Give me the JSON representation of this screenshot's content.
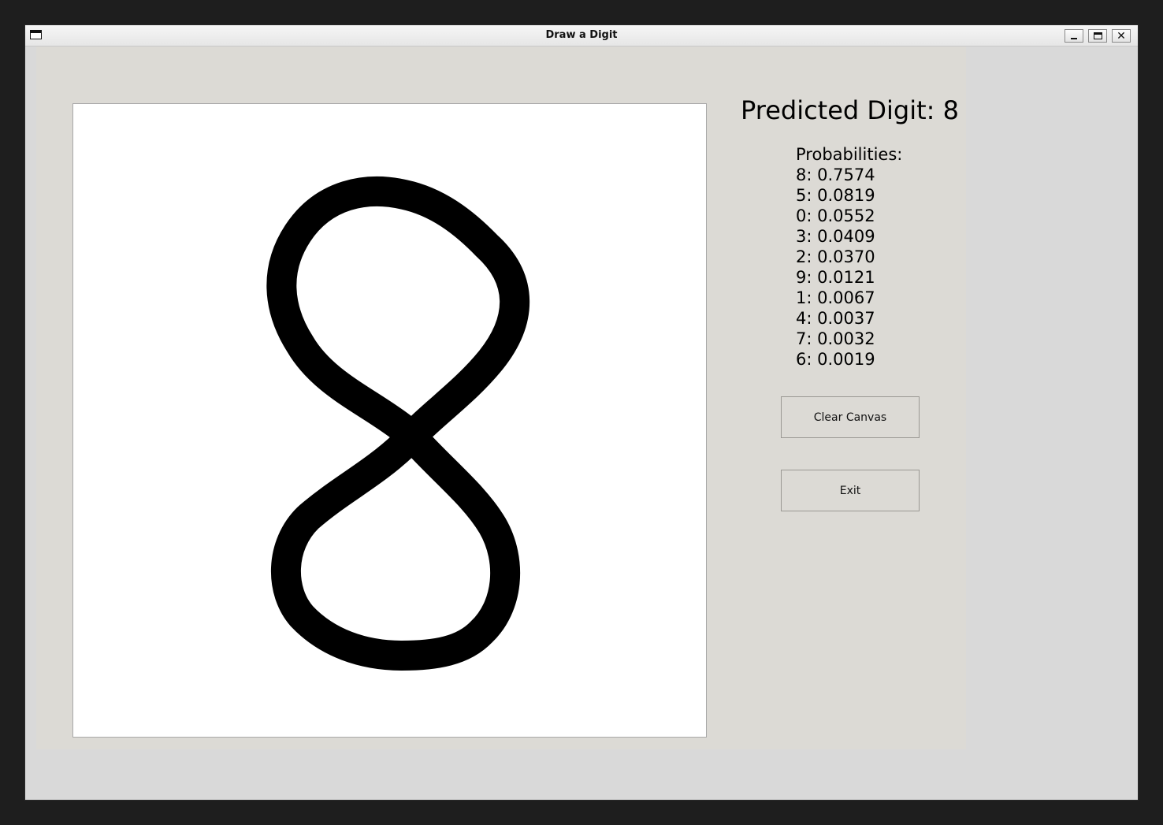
{
  "window": {
    "title": "Draw a Digit",
    "close_glyph": "✕"
  },
  "prediction": {
    "label": "Predicted Digit: 8"
  },
  "probabilities": {
    "heading": "Probabilities:",
    "items": [
      {
        "digit": "8",
        "value": "0.7574"
      },
      {
        "digit": "5",
        "value": "0.0819"
      },
      {
        "digit": "0",
        "value": "0.0552"
      },
      {
        "digit": "3",
        "value": "0.0409"
      },
      {
        "digit": "2",
        "value": "0.0370"
      },
      {
        "digit": "9",
        "value": "0.0121"
      },
      {
        "digit": "1",
        "value": "0.0067"
      },
      {
        "digit": "4",
        "value": "0.0037"
      },
      {
        "digit": "7",
        "value": "0.0032"
      },
      {
        "digit": "6",
        "value": "0.0019"
      }
    ]
  },
  "buttons": {
    "clear": "Clear Canvas",
    "exit": "Exit"
  },
  "icons": {
    "app": "window-icon",
    "minimize": "minimize-icon",
    "maximize": "maximize-icon",
    "close": "close-icon"
  }
}
